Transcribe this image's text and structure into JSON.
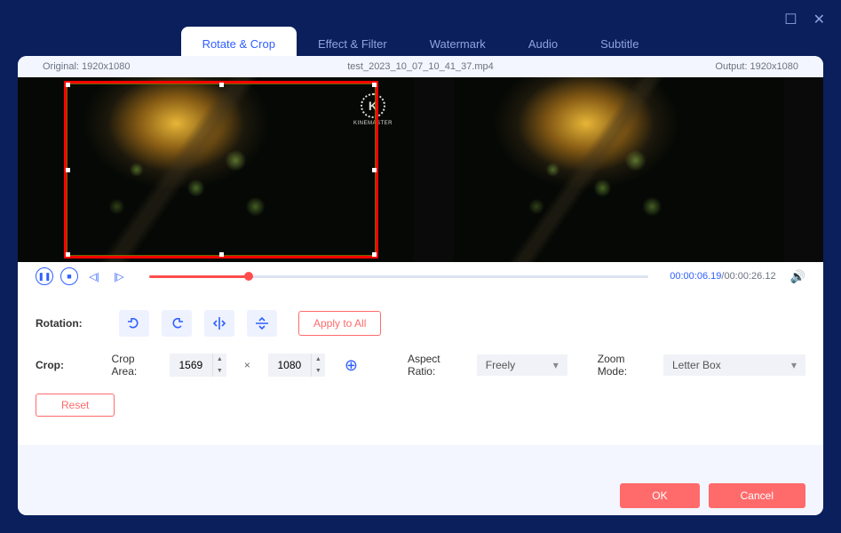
{
  "window": {
    "maximize": "☐",
    "close": "✕"
  },
  "tabs": {
    "rotate_crop": "Rotate & Crop",
    "effect_filter": "Effect & Filter",
    "watermark": "Watermark",
    "audio": "Audio",
    "subtitle": "Subtitle"
  },
  "info": {
    "original_label": "Original: 1920x1080",
    "filename": "test_2023_10_07_10_41_37.mp4",
    "output_label": "Output: 1920x1080"
  },
  "logo": {
    "letter": "K",
    "text": "KINEMASTER"
  },
  "playback": {
    "current": "00:00:06.19",
    "total": "/00:00:26.12"
  },
  "rotation": {
    "label": "Rotation:",
    "apply_all": "Apply to All"
  },
  "crop": {
    "label": "Crop:",
    "area_label": "Crop Area:",
    "width": "1569",
    "height": "1080",
    "times": "×",
    "aspect_label": "Aspect Ratio:",
    "aspect_value": "Freely",
    "zoom_label": "Zoom Mode:",
    "zoom_value": "Letter Box"
  },
  "reset": "Reset",
  "footer": {
    "ok": "OK",
    "cancel": "Cancel"
  }
}
